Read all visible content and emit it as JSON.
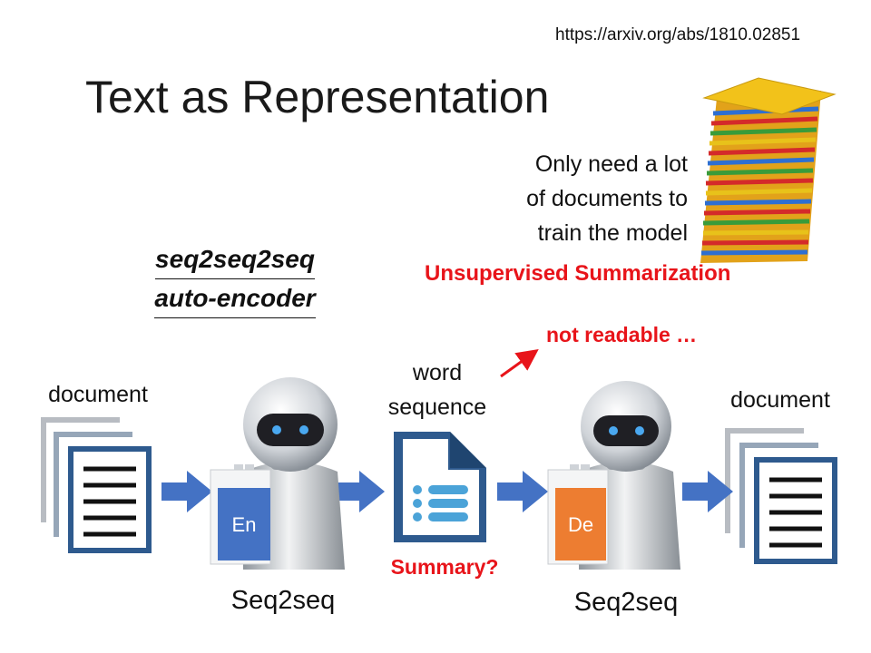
{
  "source_url": "https://arxiv.org/abs/1810.02851",
  "title": "Text as Representation",
  "note_lines": [
    "Only need a lot",
    "of documents to",
    "train the model"
  ],
  "unsupervised_label": "Unsupervised Summarization",
  "model_name": {
    "line1": "seq2seq2seq",
    "line2": "auto-encoder"
  },
  "not_readable": "not readable …",
  "input_document_label": "document",
  "output_document_label": "document",
  "word_sequence_label": {
    "line1": "word",
    "line2": "sequence"
  },
  "summary_label": "Summary?",
  "encoder": {
    "chip": "En",
    "caption": "Seq2seq"
  },
  "decoder": {
    "chip": "De",
    "caption": "Seq2seq"
  },
  "colors": {
    "accent_red": "#e8141a",
    "arrow_blue": "#4472c4",
    "doc_blue": "#2e5a8e",
    "chip_blue": "#4472c4",
    "chip_orange": "#ed7d31"
  },
  "icons": [
    "document-stack-icon",
    "robot-encoder-icon",
    "word-sequence-icon",
    "robot-decoder-icon",
    "paper-stack-icon"
  ]
}
